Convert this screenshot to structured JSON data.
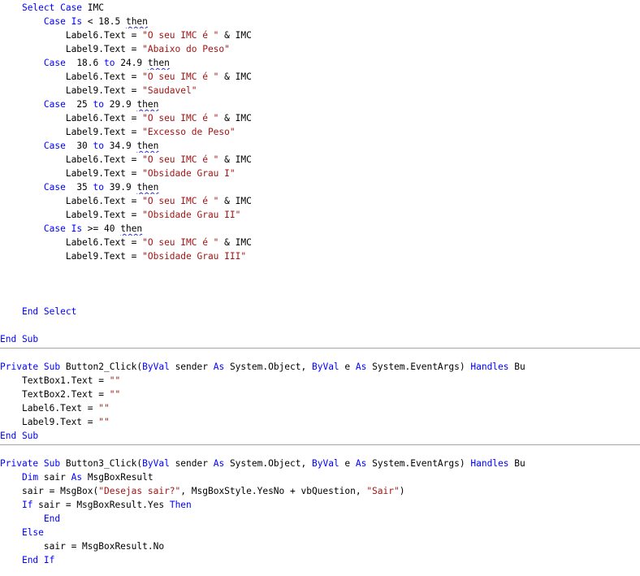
{
  "colors": {
    "keyword": "#0000ff",
    "string": "#a31515",
    "text": "#000000",
    "separator": "#a6a6a6",
    "squiggle": "#2b2bd4"
  },
  "code": {
    "select_case": {
      "kw": "Select Case",
      "rest": " IMC"
    },
    "cases": [
      {
        "case_kw": "Case",
        "cond": [
          {
            "k": "kw",
            "t": " Is"
          },
          {
            "k": "t",
            "t": " < 18.5 "
          },
          {
            "k": "sq",
            "t": "then"
          }
        ],
        "label6": {
          "obj": "Label6.Text = ",
          "str": "\"O seu IMC é \"",
          "tail": " & IMC"
        },
        "label9": {
          "obj": "Label9.Text = ",
          "str": "\"Abaixo do Peso\""
        }
      },
      {
        "case_kw": "Case",
        "cond": [
          {
            "k": "t",
            "t": "  18.6 "
          },
          {
            "k": "kw",
            "t": "to"
          },
          {
            "k": "t",
            "t": " 24.9 "
          },
          {
            "k": "sq",
            "t": "then"
          }
        ],
        "label6": {
          "obj": "Label6.Text = ",
          "str": "\"O seu IMC é \"",
          "tail": " & IMC"
        },
        "label9": {
          "obj": "Label9.Text = ",
          "str": "\"Saudavel\""
        }
      },
      {
        "case_kw": "Case",
        "cond": [
          {
            "k": "t",
            "t": "  25 "
          },
          {
            "k": "kw",
            "t": "to"
          },
          {
            "k": "t",
            "t": " 29.9 "
          },
          {
            "k": "sq",
            "t": "then"
          }
        ],
        "label6": {
          "obj": "Label6.Text = ",
          "str": "\"O seu IMC é \"",
          "tail": " & IMC"
        },
        "label9": {
          "obj": "Label9.Text = ",
          "str": "\"Excesso de Peso\""
        }
      },
      {
        "case_kw": "Case",
        "cond": [
          {
            "k": "t",
            "t": "  30 "
          },
          {
            "k": "kw",
            "t": "to"
          },
          {
            "k": "t",
            "t": " 34.9 "
          },
          {
            "k": "sq",
            "t": "then"
          }
        ],
        "label6": {
          "obj": "Label6.Text = ",
          "str": "\"O seu IMC é \"",
          "tail": " & IMC"
        },
        "label9": {
          "obj": "Label9.Text = ",
          "str": "\"Obsidade Grau I\""
        }
      },
      {
        "case_kw": "Case",
        "cond": [
          {
            "k": "t",
            "t": "  35 "
          },
          {
            "k": "kw",
            "t": "to"
          },
          {
            "k": "t",
            "t": " 39.9 "
          },
          {
            "k": "sq",
            "t": "then"
          }
        ],
        "label6": {
          "obj": "Label6.Text = ",
          "str": "\"O seu IMC é \"",
          "tail": " & IMC"
        },
        "label9": {
          "obj": "Label9.Text = ",
          "str": "\"Obsidade Grau II\""
        }
      },
      {
        "case_kw": "Case",
        "cond": [
          {
            "k": "kw",
            "t": " Is"
          },
          {
            "k": "t",
            "t": " >= 40 "
          },
          {
            "k": "sq",
            "t": "then"
          }
        ],
        "label6": {
          "obj": "Label6.Text = ",
          "str": "\"O seu IMC é \"",
          "tail": " & IMC"
        },
        "label9": {
          "obj": "Label9.Text = ",
          "str": "\"Obsidade Grau III\""
        }
      }
    ],
    "end_select": "End Select",
    "end_sub": "End Sub",
    "button2": {
      "sig": [
        {
          "k": "kw",
          "t": "Private Sub"
        },
        {
          "k": "t",
          "t": " Button2_Click("
        },
        {
          "k": "kw",
          "t": "ByVal"
        },
        {
          "k": "t",
          "t": " sender "
        },
        {
          "k": "kw",
          "t": "As"
        },
        {
          "k": "t",
          "t": " System.Object, "
        },
        {
          "k": "kw",
          "t": "ByVal"
        },
        {
          "k": "t",
          "t": " e "
        },
        {
          "k": "kw",
          "t": "As"
        },
        {
          "k": "t",
          "t": " System.EventArgs) "
        },
        {
          "k": "kw",
          "t": "Handles"
        },
        {
          "k": "t",
          "t": " Bu"
        }
      ],
      "body": [
        {
          "obj": "TextBox1.Text = ",
          "str": "\"\""
        },
        {
          "obj": "TextBox2.Text = ",
          "str": "\"\""
        },
        {
          "obj": "Label6.Text = ",
          "str": "\"\""
        },
        {
          "obj": "Label9.Text = ",
          "str": "\"\""
        }
      ],
      "end": "End Sub"
    },
    "button3": {
      "sig": [
        {
          "k": "kw",
          "t": "Private Sub"
        },
        {
          "k": "t",
          "t": " Button3_Click("
        },
        {
          "k": "kw",
          "t": "ByVal"
        },
        {
          "k": "t",
          "t": " sender "
        },
        {
          "k": "kw",
          "t": "As"
        },
        {
          "k": "t",
          "t": " System.Object, "
        },
        {
          "k": "kw",
          "t": "ByVal"
        },
        {
          "k": "t",
          "t": " e "
        },
        {
          "k": "kw",
          "t": "As"
        },
        {
          "k": "t",
          "t": " System.EventArgs) "
        },
        {
          "k": "kw",
          "t": "Handles"
        },
        {
          "k": "t",
          "t": " Bu"
        }
      ],
      "dim": [
        {
          "k": "kw",
          "t": "Dim"
        },
        {
          "k": "t",
          "t": " sair "
        },
        {
          "k": "kw",
          "t": "As"
        },
        {
          "k": "t",
          "t": " MsgBoxResult"
        }
      ],
      "msgbox": [
        {
          "k": "t",
          "t": "sair = MsgBox("
        },
        {
          "k": "str",
          "t": "\"Desejas sair?\""
        },
        {
          "k": "t",
          "t": ", MsgBoxStyle.YesNo + vbQuestion, "
        },
        {
          "k": "str",
          "t": "\"Sair\""
        },
        {
          "k": "t",
          "t": ")"
        }
      ],
      "if_line": [
        {
          "k": "kw",
          "t": "If"
        },
        {
          "k": "t",
          "t": " sair = MsgBoxResult.Yes "
        },
        {
          "k": "kw",
          "t": "Then"
        }
      ],
      "end_inner": "End",
      "else_kw": "Else",
      "else_body": "sair = MsgBoxResult.No",
      "end_if": "End If"
    }
  }
}
